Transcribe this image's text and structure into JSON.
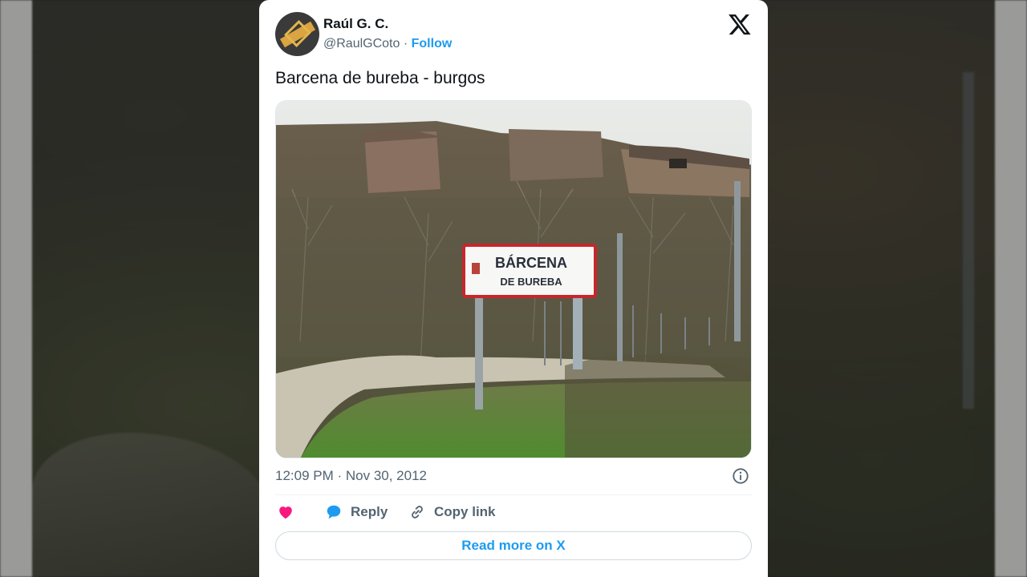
{
  "tweet": {
    "author_name": "Raúl G. C.",
    "author_handle": "@RaulGCoto",
    "separator": "·",
    "follow_label": "Follow",
    "text": "Barcena de bureba - burgos",
    "timestamp": "12:09 PM · Nov 30, 2012",
    "photo": {
      "sign_line1": "BÁRCENA",
      "sign_line2": "DE BUREBA"
    }
  },
  "actions": {
    "like_label": "",
    "reply_label": "Reply",
    "copy_label": "Copy link",
    "read_more_label": "Read more on X"
  },
  "icons": {
    "brand": "x-logo-icon",
    "like": "heart-icon",
    "reply": "speech-bubble-icon",
    "copy": "link-icon",
    "info": "info-icon"
  },
  "colors": {
    "accent": "#1d9bf0",
    "like": "#f91880",
    "text": "#0f1419",
    "muted": "#536471"
  }
}
